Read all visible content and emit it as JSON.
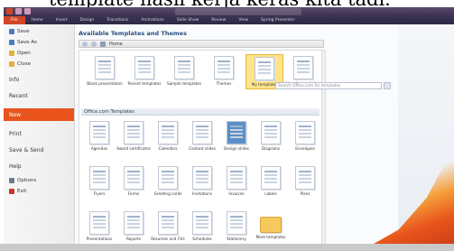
{
  "caption": "template hasil kerja keras kita tadi.",
  "ribbon_tabs": [
    "File",
    "Home",
    "Insert",
    "Design",
    "Transitions",
    "Animations",
    "Slide Show",
    "Review",
    "View",
    "Spring Presenter"
  ],
  "backstage": {
    "items": [
      {
        "label": "Save",
        "color": "#4a7cc0"
      },
      {
        "label": "Save As",
        "color": "#4a7cc0"
      },
      {
        "label": "Open",
        "color": "#e0b23c"
      },
      {
        "label": "Close",
        "color": "#e0b23c"
      },
      {
        "label": "Info",
        "color": ""
      },
      {
        "label": "Recent",
        "color": ""
      },
      {
        "label": "New",
        "color": ""
      },
      {
        "label": "Print",
        "color": ""
      },
      {
        "label": "Save & Send",
        "color": ""
      },
      {
        "label": "Help",
        "color": ""
      },
      {
        "label": "Options",
        "color": "#6a7b90"
      },
      {
        "label": "Exit",
        "color": "#c8382a"
      }
    ]
  },
  "main": {
    "header": "Available Templates and Themes",
    "breadcrumb_home": "Home",
    "top_tiles": [
      "Blank presentation",
      "Recent templates",
      "Sample templates",
      "Themes",
      "My templates",
      "New from existing"
    ],
    "section_title": "Office.com Templates",
    "search_placeholder": "Search Office.com for templates",
    "office_tiles": [
      "Agendas",
      "Award certificates",
      "Calendars",
      "Content slides",
      "Design slides",
      "Diagrams",
      "Envelopes",
      "Flyers",
      "Forms",
      "Greeting cards",
      "Invitations",
      "Invoices",
      "Labels",
      "Plans",
      "Presentations",
      "Reports",
      "Resumes and CVs",
      "Schedules",
      "Stationery",
      "More templates"
    ]
  }
}
